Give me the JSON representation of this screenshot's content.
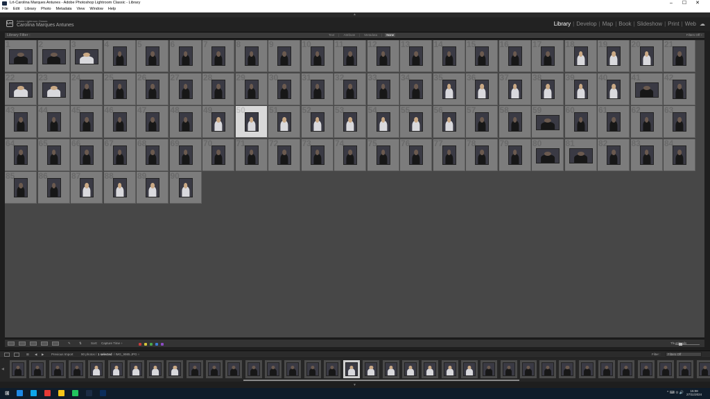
{
  "window": {
    "title": "Lrt-Carolina Marques Antunes - Adobe Photoshop Lightroom Classic - Library",
    "minimize": "–",
    "maximize": "☐",
    "close": "✕"
  },
  "menu": [
    "File",
    "Edit",
    "Library",
    "Photo",
    "Metadata",
    "View",
    "Window",
    "Help"
  ],
  "identity": {
    "logo": "Lrc",
    "product_line": "Adobe Lightroom Classic",
    "name": "Carolina Marques Antunes"
  },
  "modules": [
    "Library",
    "Develop",
    "Map",
    "Book",
    "Slideshow",
    "Print",
    "Web"
  ],
  "active_module": "Library",
  "filter_bar": {
    "title": "Library Filter :",
    "tabs": [
      "Text",
      "Attribute",
      "Metadata",
      "None"
    ],
    "active_tab": "None",
    "filters_off": "Filters Off ÷"
  },
  "grid": {
    "selected_index": 49,
    "cells": [
      {
        "n": "1",
        "p": "dark"
      },
      {
        "n": "2",
        "p": "dark"
      },
      {
        "n": "3",
        "p": "light"
      },
      {
        "n": "4",
        "p": "dark"
      },
      {
        "n": "5",
        "p": "dark"
      },
      {
        "n": "6",
        "p": "dark"
      },
      {
        "n": "7",
        "p": "dark"
      },
      {
        "n": "8",
        "p": "dark"
      },
      {
        "n": "9",
        "p": "dark"
      },
      {
        "n": "10",
        "p": "dark"
      },
      {
        "n": "11",
        "p": "dark"
      },
      {
        "n": "12",
        "p": "dark"
      },
      {
        "n": "13",
        "p": "dark"
      },
      {
        "n": "14",
        "p": "dark"
      },
      {
        "n": "15",
        "p": "dark"
      },
      {
        "n": "16",
        "p": "dark"
      },
      {
        "n": "17",
        "p": "dark"
      },
      {
        "n": "18",
        "p": "light"
      },
      {
        "n": "19",
        "p": "light"
      },
      {
        "n": "20",
        "p": "light"
      },
      {
        "n": "21",
        "p": "dark"
      },
      {
        "n": "22",
        "p": "light"
      },
      {
        "n": "23",
        "p": "light"
      },
      {
        "n": "24",
        "p": "dark"
      },
      {
        "n": "25",
        "p": "dark"
      },
      {
        "n": "26",
        "p": "dark"
      },
      {
        "n": "27",
        "p": "dark"
      },
      {
        "n": "28",
        "p": "dark"
      },
      {
        "n": "29",
        "p": "dark"
      },
      {
        "n": "30",
        "p": "dark"
      },
      {
        "n": "31",
        "p": "dark"
      },
      {
        "n": "32",
        "p": "dark"
      },
      {
        "n": "33",
        "p": "dark"
      },
      {
        "n": "34",
        "p": "dark"
      },
      {
        "n": "35",
        "p": "light"
      },
      {
        "n": "36",
        "p": "light"
      },
      {
        "n": "37",
        "p": "light"
      },
      {
        "n": "38",
        "p": "light"
      },
      {
        "n": "39",
        "p": "light"
      },
      {
        "n": "40",
        "p": "light"
      },
      {
        "n": "41",
        "p": "dark"
      },
      {
        "n": "42",
        "p": "dark"
      },
      {
        "n": "43",
        "p": "dark"
      },
      {
        "n": "44",
        "p": "dark"
      },
      {
        "n": "45",
        "p": "dark"
      },
      {
        "n": "46",
        "p": "dark"
      },
      {
        "n": "47",
        "p": "dark"
      },
      {
        "n": "48",
        "p": "dark"
      },
      {
        "n": "49",
        "p": "light"
      },
      {
        "n": "50",
        "p": "light"
      },
      {
        "n": "51",
        "p": "light"
      },
      {
        "n": "52",
        "p": "light"
      },
      {
        "n": "53",
        "p": "light"
      },
      {
        "n": "54",
        "p": "light"
      },
      {
        "n": "55",
        "p": "light"
      },
      {
        "n": "56",
        "p": "light"
      },
      {
        "n": "57",
        "p": "dark"
      },
      {
        "n": "58",
        "p": "dark"
      },
      {
        "n": "59",
        "p": "dark"
      },
      {
        "n": "60",
        "p": "dark"
      },
      {
        "n": "61",
        "p": "dark"
      },
      {
        "n": "62",
        "p": "dark"
      },
      {
        "n": "63",
        "p": "dark"
      },
      {
        "n": "64",
        "p": "dark"
      },
      {
        "n": "65",
        "p": "dark"
      },
      {
        "n": "66",
        "p": "dark"
      },
      {
        "n": "67",
        "p": "dark"
      },
      {
        "n": "68",
        "p": "dark"
      },
      {
        "n": "69",
        "p": "dark"
      },
      {
        "n": "70",
        "p": "dark"
      },
      {
        "n": "71",
        "p": "dark"
      },
      {
        "n": "72",
        "p": "dark"
      },
      {
        "n": "73",
        "p": "dark"
      },
      {
        "n": "74",
        "p": "dark"
      },
      {
        "n": "75",
        "p": "dark"
      },
      {
        "n": "76",
        "p": "dark"
      },
      {
        "n": "77",
        "p": "dark"
      },
      {
        "n": "78",
        "p": "dark"
      },
      {
        "n": "79",
        "p": "dark"
      },
      {
        "n": "80",
        "p": "dark"
      },
      {
        "n": "81",
        "p": "dark"
      },
      {
        "n": "82",
        "p": "dark"
      },
      {
        "n": "83",
        "p": "dark"
      },
      {
        "n": "84",
        "p": "dark"
      },
      {
        "n": "85",
        "p": "dark"
      },
      {
        "n": "86",
        "p": "dark"
      },
      {
        "n": "87",
        "p": "light"
      },
      {
        "n": "88",
        "p": "light"
      },
      {
        "n": "89",
        "p": "light"
      },
      {
        "n": "90",
        "p": "light"
      }
    ]
  },
  "toolbar": {
    "sort_label": "Sort:",
    "sort_value": "Capture Time ÷",
    "thumbnails_label": "Thumbnails",
    "color_labels": [
      "#c83c3c",
      "#d4c43c",
      "#4ca84c",
      "#3c7cd4",
      "#8c4cc4"
    ]
  },
  "filmstrip_header": {
    "source": "Previous Import",
    "count": "90 photos /",
    "selected": "1 selected",
    "filename": "/ IMG_9985.JPG ÷",
    "filter_label": "Filter :",
    "filter_value": "Filters Off"
  },
  "filmstrip": {
    "selected_index": 17,
    "thumbs": [
      "dark",
      "dark",
      "dark",
      "dark",
      "light",
      "light",
      "light",
      "light",
      "light",
      "dark",
      "dark",
      "dark",
      "dark",
      "dark",
      "dark",
      "dark",
      "dark",
      "light",
      "light",
      "light",
      "light",
      "light",
      "light",
      "light",
      "dark",
      "dark",
      "dark",
      "dark",
      "dark",
      "dark",
      "dark",
      "dark",
      "dark",
      "dark",
      "dark",
      "dark"
    ]
  },
  "taskbar": {
    "time": "15:08",
    "date": "27/11/2024",
    "sys": "^ ⌨ ⊙ 🔊",
    "icons": [
      "#1e88e5",
      "#0ea5e9",
      "#e53935",
      "#f5c518",
      "#22c55e",
      "#1c2c44",
      "#0b2d5b"
    ]
  }
}
